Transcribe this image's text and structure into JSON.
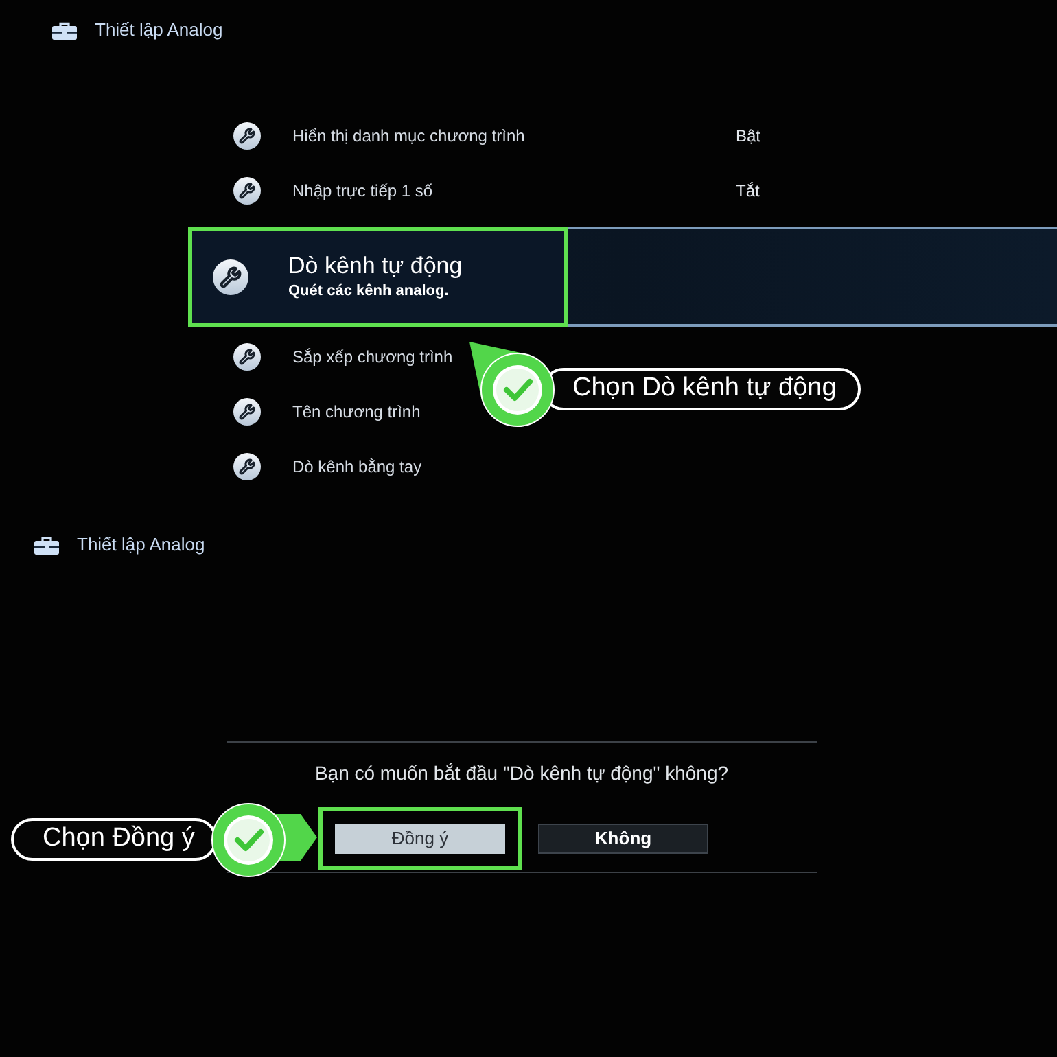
{
  "menu_screen": {
    "header": {
      "title": "Thiết lập Analog"
    },
    "menu": [
      {
        "label": "Hiển thị danh mục chương trình",
        "value": "Bật",
        "selected": false
      },
      {
        "label": "Nhập trực tiếp 1 số",
        "value": "Tắt",
        "selected": false
      },
      {
        "label": "Dò kênh tự động",
        "description": "Quét các kênh analog.",
        "selected": true
      },
      {
        "label": "Sắp xếp chương trình",
        "selected": false
      },
      {
        "label": "Tên chương trình",
        "selected": false
      },
      {
        "label": "Dò kênh bằng tay",
        "selected": false
      }
    ],
    "callout": {
      "text": "Chọn Dò kênh tự động"
    }
  },
  "confirm_screen": {
    "header": {
      "title": "Thiết lập Analog"
    },
    "dialog": {
      "question": "Bạn có muốn bắt đầu \"Dò kênh tự động\" không?",
      "buttons": [
        {
          "label": "Đồng ý",
          "selected": true
        },
        {
          "label": "Không",
          "selected": false
        }
      ]
    },
    "callout": {
      "text": "Chọn Đồng ý"
    }
  }
}
